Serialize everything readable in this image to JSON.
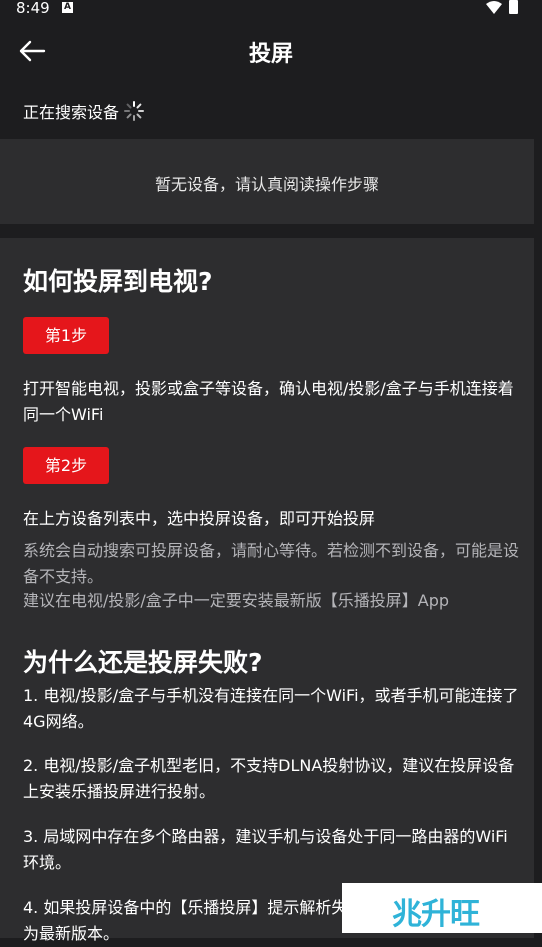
{
  "status_bar": {
    "time": "8:49",
    "notification_glyph": "A"
  },
  "app_bar": {
    "title": "投屏"
  },
  "search": {
    "status": "正在搜索设备"
  },
  "devices": {
    "empty_message": "暂无设备，请认真阅读操作步骤"
  },
  "guide": {
    "heading": "如何投屏到电视?",
    "step1": {
      "label": "第1步",
      "text": "打开智能电视，投影或盒子等设备，确认电视/投影/盒子与手机连接着同一个WiFi"
    },
    "step2": {
      "label": "第2步",
      "text": "在上方设备列表中，选中投屏设备，即可开始投屏",
      "note1": "系统会自动搜索可投屏设备，请耐心等待。若检测不到设备，可能是设备不支持。",
      "note2": "建议在电视/投影/盒子中一定要安装最新版【乐播投屏】App"
    },
    "faq_heading": "为什么还是投屏失败?",
    "faq": [
      "1. 电视/投影/盒子与手机没有连接在同一个WiFi，或者手机可能连接了4G网络。",
      " 2. 电视/投影/盒子机型老旧，不支持DLNA投射协议，建议在投屏设备上安装乐播投屏进行投射。",
      " 3. 局域网中存在多个路由器，建议手机与设备处于同一路由器的WiFi环境。",
      " 4. 如果投屏设备中的【乐播投屏】提示解析失败，请升级乐播投屏App为最新版本。"
    ]
  },
  "watermark": {
    "text": "兆升旺"
  }
}
